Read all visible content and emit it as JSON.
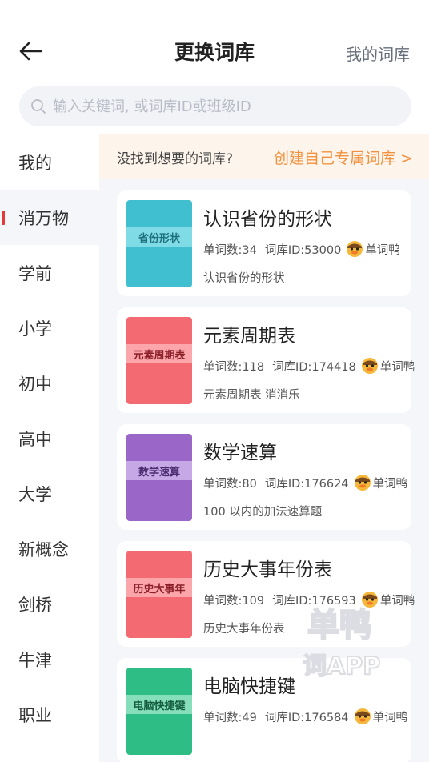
{
  "header": {
    "title": "更换词库",
    "my_library": "我的词库",
    "back_icon": "arrow-left-icon"
  },
  "search": {
    "placeholder": "输入关键词, 或词库ID或班级ID",
    "value": ""
  },
  "sidebar": {
    "items": [
      {
        "label": "我的",
        "active": false
      },
      {
        "label": "消万物",
        "active": true
      },
      {
        "label": "学前",
        "active": false
      },
      {
        "label": "小学",
        "active": false
      },
      {
        "label": "初中",
        "active": false
      },
      {
        "label": "高中",
        "active": false
      },
      {
        "label": "大学",
        "active": false
      },
      {
        "label": "新概念",
        "active": false
      },
      {
        "label": "剑桥",
        "active": false
      },
      {
        "label": "牛津",
        "active": false
      },
      {
        "label": "职业",
        "active": false
      }
    ]
  },
  "banner": {
    "text": "没找到想要的词库?",
    "link": "创建自己专属词库 >"
  },
  "colors": {
    "accent": "#e23a3a",
    "link_orange": "#f2913d"
  },
  "cards": [
    {
      "title": "认识省份的形状",
      "cover_text": "省份形状",
      "cover_color": "#3fbfcf",
      "band_color": "#7fdbe6",
      "text_color": "#1d6f7c",
      "count": "单词数:34",
      "lib_id": "词库ID:53000",
      "author": "单词鸭",
      "desc": "认识省份的形状"
    },
    {
      "title": "元素周期表",
      "cover_text": "元素周期表",
      "cover_color": "#f46a73",
      "band_color": "#fca6ab",
      "text_color": "#8a1f28",
      "count": "单词数:118",
      "lib_id": "词库ID:174418",
      "author": "单词鸭",
      "desc": "元素周期表 消消乐"
    },
    {
      "title": "数学速算",
      "cover_text": "数学速算",
      "cover_color": "#9a67c9",
      "band_color": "#c7a8e6",
      "text_color": "#4a2a6e",
      "count": "单词数:80",
      "lib_id": "词库ID:176624",
      "author": "单词鸭",
      "desc": "100 以内的加法速算题"
    },
    {
      "title": "历史大事年份表",
      "cover_text": "历史大事年",
      "cover_color": "#f46a73",
      "band_color": "#fca6ab",
      "text_color": "#8a1f28",
      "count": "单词数:109",
      "lib_id": "词库ID:176593",
      "author": "单词鸭",
      "desc": "历史大事年份表"
    },
    {
      "title": "电脑快捷键",
      "cover_text": "电脑快捷键",
      "cover_color": "#2ebd85",
      "band_color": "#86dfba",
      "text_color": "#135c3f",
      "count": "单词数:49",
      "lib_id": "词库ID:176584",
      "author": "单词鸭",
      "desc": ""
    }
  ],
  "watermark": {
    "line1": "单鸭",
    "line2": "词APP"
  }
}
